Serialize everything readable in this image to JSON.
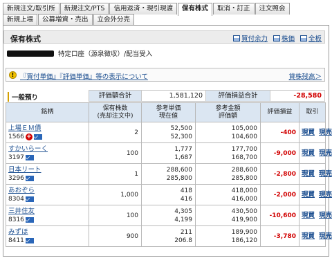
{
  "tabs_row1": [
    "新規注文/取引所",
    "新規注文/PTS",
    "信用返済・現引現渡",
    "保有株式",
    "取消・訂正",
    "注文照会"
  ],
  "tabs_row2": [
    "新規上場",
    "公募増資・売出",
    "立会外分売"
  ],
  "active_tab": "保有株式",
  "header": {
    "title": "保有株式",
    "links": [
      {
        "label": "買付余力",
        "icon": "window-icon"
      },
      {
        "label": "株価",
        "icon": "window-icon"
      },
      {
        "label": "全板",
        "icon": "window-icon"
      }
    ]
  },
  "account": {
    "label": "特定口座（源泉徴収）/配当受入"
  },
  "notice": {
    "icon": "warning-icon",
    "text": "『買付単価』『評価単価』等の表示について",
    "right_link": "貸株残高＞"
  },
  "summary": {
    "section_label": "一般預り",
    "valuation_label": "評価額合計",
    "valuation_value": "1,581,120",
    "pl_label": "評価損益合計",
    "pl_value": "-28,580"
  },
  "table": {
    "headers": {
      "name": "銘柄",
      "qty": "保有株数\n(売却注文中)",
      "price": "参考単価\n現在値",
      "amount": "参考金額\n評価額",
      "pl": "評価損益",
      "trade": "取引"
    },
    "rows": [
      {
        "name": "上場ＥＭ債",
        "code": "1566",
        "plus": true,
        "qty": "2",
        "ref_price": "52,500",
        "cur_price": "52,300",
        "ref_amount": "105,000",
        "val_amount": "104,600",
        "pl": "-400",
        "buy": "現買",
        "sell": "現売"
      },
      {
        "name": "すかいらーく",
        "code": "3197",
        "plus": false,
        "qty": "100",
        "ref_price": "1,777",
        "cur_price": "1,687",
        "ref_amount": "177,700",
        "val_amount": "168,700",
        "pl": "-9,000",
        "buy": "現買",
        "sell": "現売"
      },
      {
        "name": "日本リート",
        "code": "3296",
        "plus": false,
        "qty": "1",
        "ref_price": "288,600",
        "cur_price": "285,800",
        "ref_amount": "288,600",
        "val_amount": "285,800",
        "pl": "-2,800",
        "buy": "現買",
        "sell": "現売"
      },
      {
        "name": "あおぞら",
        "code": "8304",
        "plus": false,
        "qty": "1,000",
        "ref_price": "418",
        "cur_price": "416",
        "ref_amount": "418,000",
        "val_amount": "416,000",
        "pl": "-2,000",
        "buy": "現買",
        "sell": "現売"
      },
      {
        "name": "三井住友",
        "code": "8316",
        "plus": false,
        "qty": "100",
        "ref_price": "4,305",
        "cur_price": "4,199",
        "ref_amount": "430,500",
        "val_amount": "419,900",
        "pl": "-10,600",
        "buy": "現買",
        "sell": "現売"
      },
      {
        "name": "みずほ",
        "code": "8411",
        "plus": false,
        "qty": "900",
        "ref_price": "211",
        "cur_price": "206.8",
        "ref_amount": "189,900",
        "val_amount": "186,120",
        "pl": "-3,780",
        "buy": "現買",
        "sell": "現売"
      }
    ]
  },
  "colors": {
    "link": "#1a4d8f",
    "negative": "#d10000",
    "header_bg": "#dbe6f2"
  }
}
